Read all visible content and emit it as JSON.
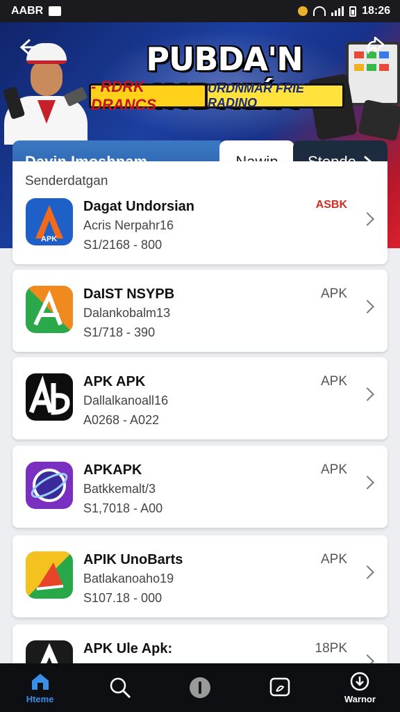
{
  "status_bar": {
    "left_text": "AABR",
    "time": "18:26"
  },
  "banner": {
    "title": "PUBDA'N INDNEÍA",
    "badge_left": "- RDRK DRANCS",
    "badge_right": "URDNMAR FRIE RADINO"
  },
  "tabs": [
    {
      "label": "Dayin Imoshnam"
    },
    {
      "label": "Nawin"
    },
    {
      "label": "Stepde"
    }
  ],
  "section": {
    "label": "Senderdatgan"
  },
  "apps": [
    {
      "name": "Dagat Undorsian",
      "developer": "Acris Nerpahr16",
      "version": "S1/2168 - 800",
      "tag": "ASBK",
      "tag_red": true,
      "icon": "apk-icon-blue"
    },
    {
      "name": "DaIST NSYPB",
      "developer": "Dalankobalm13",
      "version": "S1/718 - 390",
      "tag": "APK",
      "tag_red": false,
      "icon": "apk-icon-green-orange"
    },
    {
      "name": "APK APK",
      "developer": "Dallalkanoall16",
      "version": "A0268 - A022",
      "tag": "APK",
      "tag_red": false,
      "icon": "ab-icon-black"
    },
    {
      "name": "APKAPK",
      "developer": "Batkkemalt/3",
      "version": "S1,7018 - A00",
      "tag": "APK",
      "tag_red": false,
      "icon": "orbit-icon-purple"
    },
    {
      "name": "APIK UnoBarts",
      "developer": "Batlakanoaho19",
      "version": "S107.18 - 000",
      "tag": "APK",
      "tag_red": false,
      "icon": "apk-icon-green-yellow"
    },
    {
      "name": "APK Ule Apk:",
      "developer": "",
      "version": "",
      "tag": "18PK",
      "tag_red": false,
      "icon": "apk-icon-dark"
    }
  ],
  "nav": [
    {
      "label": "Hteme",
      "icon": "home-icon",
      "active": true
    },
    {
      "label": "",
      "icon": "search-icon",
      "active": false
    },
    {
      "label": "",
      "icon": "info-icon",
      "active": false
    },
    {
      "label": "",
      "icon": "chat-icon",
      "active": false
    },
    {
      "label": "Warnor",
      "icon": "download-icon",
      "active": false
    }
  ],
  "colors": {
    "accent": "#3a8fe8",
    "tab_blue": "#2a5ea8",
    "tag_red": "#d22a1e"
  }
}
